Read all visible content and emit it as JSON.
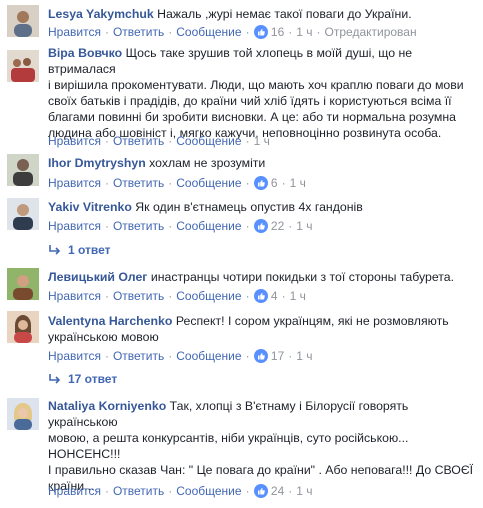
{
  "actions": {
    "like": "Нравится",
    "reply": "Ответить",
    "message": "Сообщение",
    "sep": "·"
  },
  "colors": {
    "link": "#4267b2",
    "author": "#365899",
    "meta": "#90949c",
    "like_badge": "#5890ff"
  },
  "comments": [
    {
      "author": "Lesya Yakymchuk",
      "lines": [
        "Нажаль ,журі немає такої поваги до України."
      ],
      "likes": "16",
      "time": "1 ч",
      "edited": "Отредактирован"
    },
    {
      "author": "Віра Вовчко",
      "lines": [
        "Щось таке зрушив той хлопець в моїй душі, що не втрималася",
        "і вирішила прокоментувати. Люди, що мають хоч краплю поваги до мови",
        "своїх батьків і прадідів, до країни чий хліб їдять і користуються всіма її",
        "благами повинні би зробити висновки. А це: або ти нормальна розумна",
        "людина або шовініст і, мягко кажучи, неповноцінно розвинута особа."
      ],
      "time": "1 ч"
    },
    {
      "author": "Ihor Dmytryshyn",
      "lines": [
        "хохлам не зрозуміти"
      ],
      "likes": "6",
      "time": "1 ч"
    },
    {
      "author": "Yakiv Vitrenko",
      "lines": [
        "Як один в'єтнамець опустив 4х гандонів"
      ],
      "likes": "22",
      "time": "1 ч",
      "replies": "1 ответ"
    },
    {
      "author": "Левицький Олег",
      "lines": [
        "инастранцы чотири покидьки з тої стороны табурета."
      ],
      "likes": "4",
      "time": "1 ч"
    },
    {
      "author": "Valentyna Harchenko",
      "lines": [
        "Респект! І сором українцям, які не розмовляють",
        "українською мовою"
      ],
      "likes": "17",
      "time": "1 ч",
      "replies": "17 ответ"
    },
    {
      "author": "Nataliya Korniyenko",
      "lines": [
        "Так, хлопці з В'єтнаму і Білорусії говорять українською",
        "мовою, а решта конкурсантів, ніби українців, суто російською...",
        "НОНСЕНС!!!",
        "І правильно сказав Чан: \" Це повага до країни\" . Або неповага!!! До СВОЄЇ",
        "країни..."
      ],
      "likes": "24",
      "time": "1 ч"
    }
  ]
}
